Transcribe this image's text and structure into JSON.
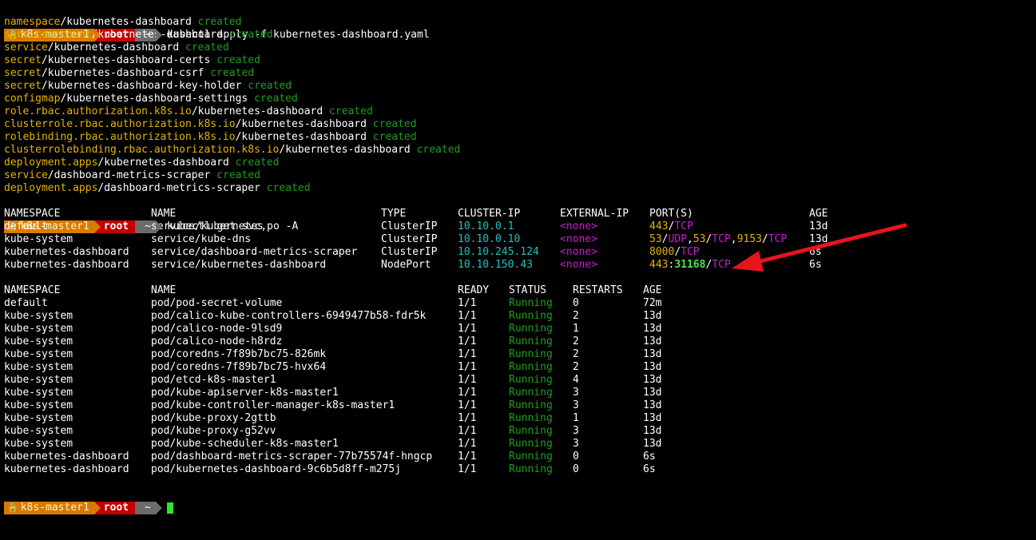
{
  "prompt": {
    "host": "k8s-master1",
    "user": "root",
    "dir": "~",
    "lock_glyph": "🔒"
  },
  "commands": {
    "apply": "kubectl apply -f kubernetes-dashboard.yaml",
    "get": "kubectl get svc,po -A"
  },
  "apply_output": [
    {
      "kind": "namespace",
      "name": "kubernetes-dashboard",
      "status": "created"
    },
    {
      "kind": "serviceaccount",
      "name": "kubernetes-dashboard",
      "status": "created"
    },
    {
      "kind": "service",
      "name": "kubernetes-dashboard",
      "status": "created"
    },
    {
      "kind": "secret",
      "name": "kubernetes-dashboard-certs",
      "status": "created"
    },
    {
      "kind": "secret",
      "name": "kubernetes-dashboard-csrf",
      "status": "created"
    },
    {
      "kind": "secret",
      "name": "kubernetes-dashboard-key-holder",
      "status": "created"
    },
    {
      "kind": "configmap",
      "name": "kubernetes-dashboard-settings",
      "status": "created"
    },
    {
      "kind": "role.rbac.authorization.k8s.io",
      "name": "kubernetes-dashboard",
      "status": "created"
    },
    {
      "kind": "clusterrole.rbac.authorization.k8s.io",
      "name": "kubernetes-dashboard",
      "status": "created"
    },
    {
      "kind": "rolebinding.rbac.authorization.k8s.io",
      "name": "kubernetes-dashboard",
      "status": "created"
    },
    {
      "kind": "clusterrolebinding.rbac.authorization.k8s.io",
      "name": "kubernetes-dashboard",
      "status": "created"
    },
    {
      "kind": "deployment.apps",
      "name": "kubernetes-dashboard",
      "status": "created"
    },
    {
      "kind": "service",
      "name": "dashboard-metrics-scraper",
      "status": "created"
    },
    {
      "kind": "deployment.apps",
      "name": "dashboard-metrics-scraper",
      "status": "created"
    }
  ],
  "svc_headers": {
    "namespace": "NAMESPACE",
    "name": "NAME",
    "type": "TYPE",
    "cluster_ip": "CLUSTER-IP",
    "external_ip": "EXTERNAL-IP",
    "ports": "PORT(S)",
    "age": "AGE"
  },
  "services": [
    {
      "namespace": "default",
      "name": "service/kubernetes",
      "type": "ClusterIP",
      "cluster_ip": "10.10.0.1",
      "external_ip": "<none>",
      "ports": [
        {
          "t": "443",
          "c": "y"
        },
        {
          "t": "/",
          "c": "w"
        },
        {
          "t": "TCP",
          "c": "m"
        }
      ],
      "age": "13d"
    },
    {
      "namespace": "kube-system",
      "name": "service/kube-dns",
      "type": "ClusterIP",
      "cluster_ip": "10.10.0.10",
      "external_ip": "<none>",
      "ports": [
        {
          "t": "53",
          "c": "y"
        },
        {
          "t": "/",
          "c": "w"
        },
        {
          "t": "UDP",
          "c": "m"
        },
        {
          "t": ",",
          "c": "w"
        },
        {
          "t": "53",
          "c": "y"
        },
        {
          "t": "/",
          "c": "w"
        },
        {
          "t": "TCP",
          "c": "m"
        },
        {
          "t": ",",
          "c": "w"
        },
        {
          "t": "9153",
          "c": "y"
        },
        {
          "t": "/",
          "c": "w"
        },
        {
          "t": "TCP",
          "c": "m"
        }
      ],
      "age": "13d"
    },
    {
      "namespace": "kubernetes-dashboard",
      "name": "service/dashboard-metrics-scraper",
      "type": "ClusterIP",
      "cluster_ip": "10.10.245.124",
      "external_ip": "<none>",
      "ports": [
        {
          "t": "8000",
          "c": "y"
        },
        {
          "t": "/",
          "c": "w"
        },
        {
          "t": "TCP",
          "c": "m"
        }
      ],
      "age": "6s"
    },
    {
      "namespace": "kubernetes-dashboard",
      "name": "service/kubernetes-dashboard",
      "type": "NodePort",
      "cluster_ip": "10.10.150.43",
      "external_ip": "<none>",
      "ports": [
        {
          "t": "443",
          "c": "y"
        },
        {
          "t": ":",
          "c": "w"
        },
        {
          "t": "31168",
          "c": "bg"
        },
        {
          "t": "/",
          "c": "w"
        },
        {
          "t": "TCP",
          "c": "m"
        }
      ],
      "age": "6s"
    }
  ],
  "pod_headers": {
    "namespace": "NAMESPACE",
    "name": "NAME",
    "ready": "READY",
    "status": "STATUS",
    "restarts": "RESTARTS",
    "age": "AGE"
  },
  "pods": [
    {
      "namespace": "default",
      "name": "pod/pod-secret-volume",
      "ready": "1/1",
      "status": "Running",
      "restarts": "0",
      "age": "72m"
    },
    {
      "namespace": "kube-system",
      "name": "pod/calico-kube-controllers-6949477b58-fdr5k",
      "ready": "1/1",
      "status": "Running",
      "restarts": "2",
      "age": "13d"
    },
    {
      "namespace": "kube-system",
      "name": "pod/calico-node-9lsd9",
      "ready": "1/1",
      "status": "Running",
      "restarts": "1",
      "age": "13d"
    },
    {
      "namespace": "kube-system",
      "name": "pod/calico-node-h8rdz",
      "ready": "1/1",
      "status": "Running",
      "restarts": "2",
      "age": "13d"
    },
    {
      "namespace": "kube-system",
      "name": "pod/coredns-7f89b7bc75-826mk",
      "ready": "1/1",
      "status": "Running",
      "restarts": "2",
      "age": "13d"
    },
    {
      "namespace": "kube-system",
      "name": "pod/coredns-7f89b7bc75-hvx64",
      "ready": "1/1",
      "status": "Running",
      "restarts": "2",
      "age": "13d"
    },
    {
      "namespace": "kube-system",
      "name": "pod/etcd-k8s-master1",
      "ready": "1/1",
      "status": "Running",
      "restarts": "4",
      "age": "13d"
    },
    {
      "namespace": "kube-system",
      "name": "pod/kube-apiserver-k8s-master1",
      "ready": "1/1",
      "status": "Running",
      "restarts": "3",
      "age": "13d"
    },
    {
      "namespace": "kube-system",
      "name": "pod/kube-controller-manager-k8s-master1",
      "ready": "1/1",
      "status": "Running",
      "restarts": "3",
      "age": "13d"
    },
    {
      "namespace": "kube-system",
      "name": "pod/kube-proxy-2gttb",
      "ready": "1/1",
      "status": "Running",
      "restarts": "1",
      "age": "13d"
    },
    {
      "namespace": "kube-system",
      "name": "pod/kube-proxy-g52vv",
      "ready": "1/1",
      "status": "Running",
      "restarts": "3",
      "age": "13d"
    },
    {
      "namespace": "kube-system",
      "name": "pod/kube-scheduler-k8s-master1",
      "ready": "1/1",
      "status": "Running",
      "restarts": "3",
      "age": "13d"
    },
    {
      "namespace": "kubernetes-dashboard",
      "name": "pod/dashboard-metrics-scraper-77b75574f-hngcp",
      "ready": "1/1",
      "status": "Running",
      "restarts": "0",
      "age": "6s"
    },
    {
      "namespace": "kubernetes-dashboard",
      "name": "pod/kubernetes-dashboard-9c6b5d8ff-m275j",
      "ready": "1/1",
      "status": "Running",
      "restarts": "0",
      "age": "6s"
    }
  ],
  "colors": {
    "background": "#000000",
    "resource_kind": "#e4b400",
    "created": "#1f9d1f",
    "cluster_ip": "#20c2c2",
    "none": "#c61fd0",
    "running": "#1f9d1f",
    "annotation_arrow": "#e8141c",
    "cursor": "#2ee52e"
  }
}
